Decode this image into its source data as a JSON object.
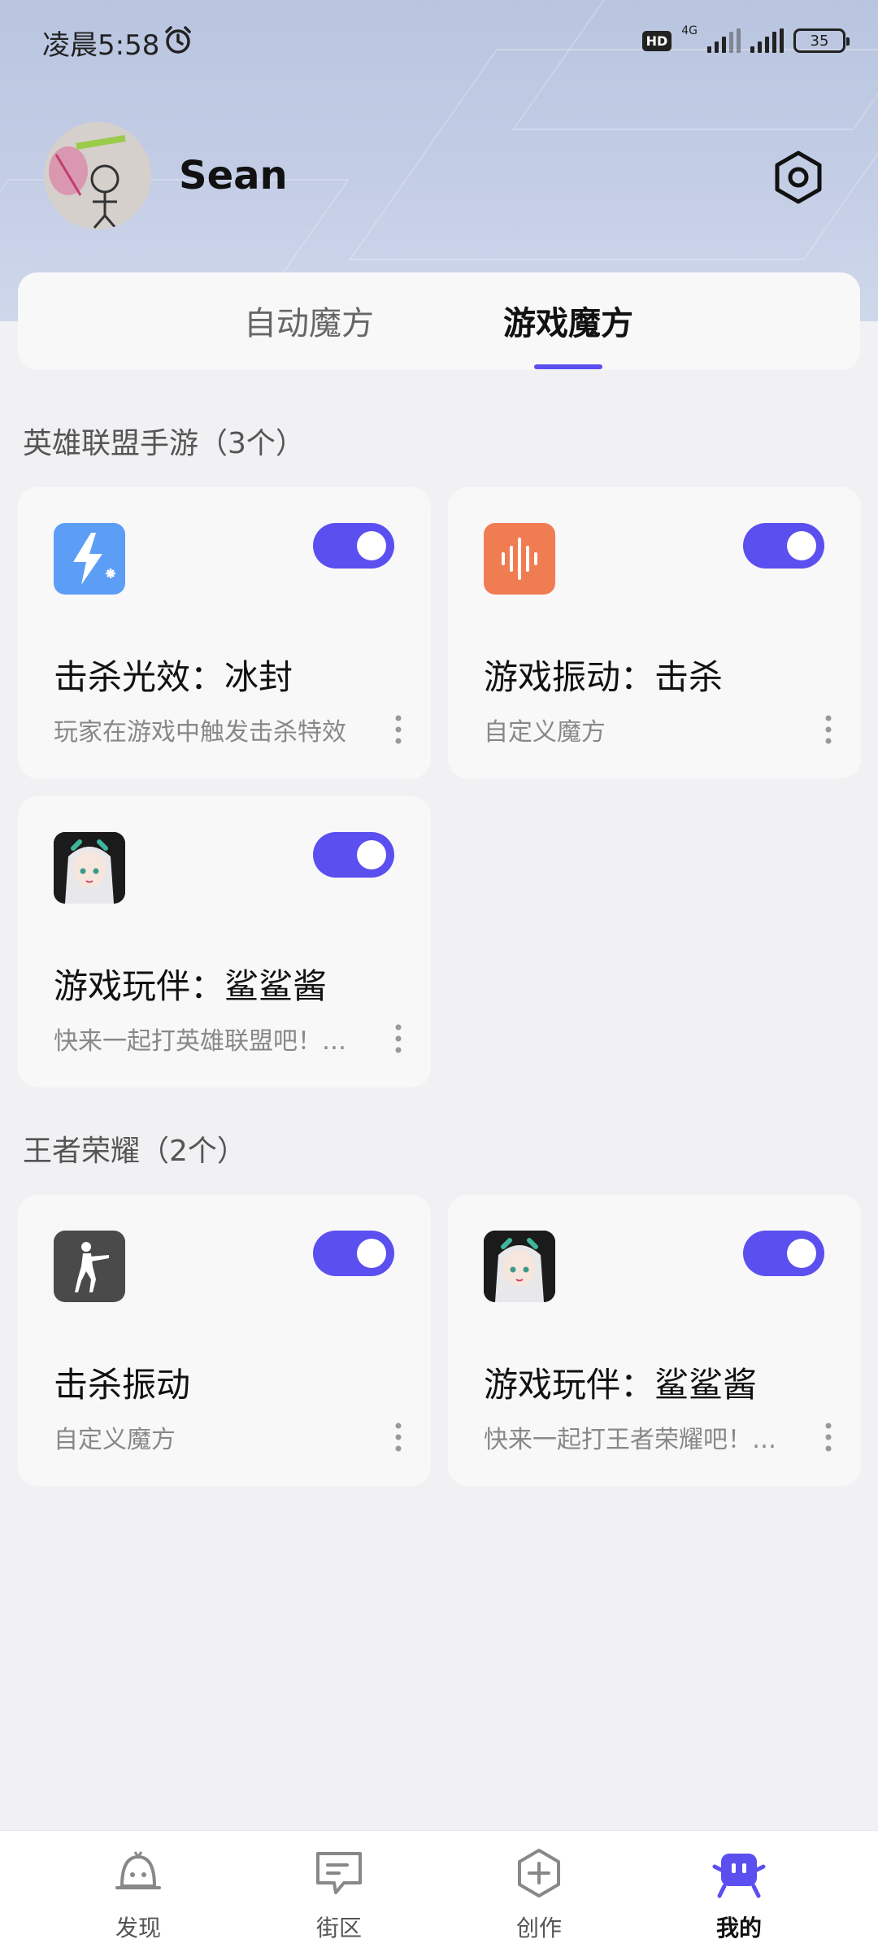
{
  "status_bar": {
    "time": "凌晨5:58",
    "hd_badge": "HD",
    "network": "4G",
    "battery": "35"
  },
  "profile": {
    "username": "Sean"
  },
  "tabs": [
    {
      "label": "自动魔方",
      "active": false
    },
    {
      "label": "游戏魔方",
      "active": true
    }
  ],
  "sections": [
    {
      "title": "英雄联盟手游（3个）",
      "cards": [
        {
          "icon": "lightning-snow-icon",
          "title": "击杀光效：冰封",
          "subtitle": "玩家在游戏中触发击杀特效",
          "enabled": true
        },
        {
          "icon": "sound-wave-icon",
          "title": "游戏振动：击杀",
          "subtitle": "自定义魔方",
          "enabled": true
        },
        {
          "icon": "anime-girl-avatar-icon",
          "title": "游戏玩伴：鲨鲨酱",
          "subtitle": "快来一起打英雄联盟吧！我是你的游戏玩伴",
          "enabled": true
        }
      ]
    },
    {
      "title": "王者荣耀（2个）",
      "cards": [
        {
          "icon": "soldier-icon",
          "title": "击杀振动",
          "subtitle": "自定义魔方",
          "enabled": true
        },
        {
          "icon": "anime-girl-avatar-icon",
          "title": "游戏玩伴：鲨鲨酱",
          "subtitle": "快来一起打王者荣耀吧！我是你的游戏玩伴",
          "enabled": true
        }
      ]
    }
  ],
  "bottom_nav": [
    {
      "label": "发现",
      "icon": "robot-icon",
      "active": false
    },
    {
      "label": "街区",
      "icon": "chat-bubble-icon",
      "active": false
    },
    {
      "label": "创作",
      "icon": "plus-hexagon-icon",
      "active": false
    },
    {
      "label": "我的",
      "icon": "mascot-icon",
      "active": true
    }
  ],
  "colors": {
    "accent": "#5b4ff0",
    "hero_bg": "#c3cde5",
    "blue_icon": "#5c9ef5",
    "orange_icon": "#f07c52",
    "gray_icon": "#4a4a4a"
  }
}
